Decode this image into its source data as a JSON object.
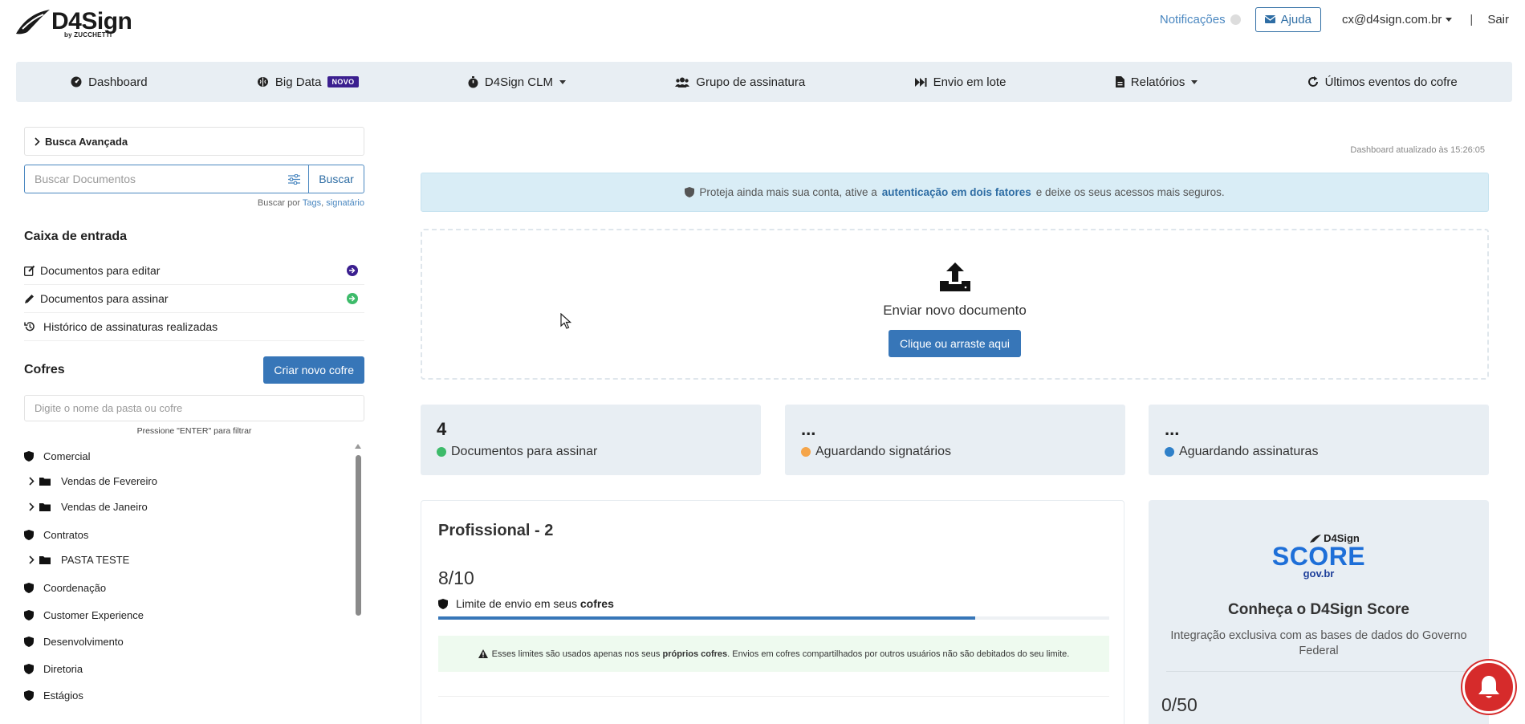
{
  "header": {
    "logo_text": "D4Sign",
    "logo_sub": "by ZUCCHETTI",
    "notifications_label": "Notificações",
    "help_label": "Ajuda",
    "user_email": "cx@d4sign.com.br",
    "separator": "|",
    "logout_label": "Sair"
  },
  "nav": {
    "items": [
      {
        "label": "Dashboard",
        "icon": "dashboard-icon"
      },
      {
        "label": "Big Data",
        "icon": "brain-icon",
        "badge": "NOVO"
      },
      {
        "label": "D4Sign CLM",
        "icon": "stopwatch-icon",
        "dropdown": true
      },
      {
        "label": "Grupo de assinatura",
        "icon": "users-icon"
      },
      {
        "label": "Envio em lote",
        "icon": "fast-forward-icon"
      },
      {
        "label": "Relatórios",
        "icon": "file-report-icon",
        "dropdown": true
      },
      {
        "label": "Últimos eventos do cofre",
        "icon": "refresh-icon"
      }
    ]
  },
  "sidebar": {
    "advanced_search": "Busca Avançada",
    "search_placeholder": "Buscar Documentos",
    "search_button": "Buscar",
    "search_hint_prefix": "Buscar por",
    "search_hint_tags": "Tags",
    "search_hint_comma": ",",
    "search_hint_signer": "signatário",
    "inbox_title": "Caixa de entrada",
    "inbox_items": [
      {
        "label": "Documentos para editar",
        "icon": "edit-icon"
      },
      {
        "label": "Documentos para assinar",
        "icon": "pencil-icon"
      },
      {
        "label": "Histórico de assinaturas realizadas",
        "icon": "history-icon"
      }
    ],
    "vaults_title": "Cofres",
    "new_vault_button": "Criar novo cofre",
    "vault_filter_placeholder": "Digite o nome da pasta ou cofre",
    "vault_filter_hint": "Pressione \"ENTER\" para filtrar",
    "vaults": [
      {
        "label": "Comercial",
        "type": "vault"
      },
      {
        "label": "Vendas de Fevereiro",
        "type": "folder"
      },
      {
        "label": "Vendas de Janeiro",
        "type": "folder"
      },
      {
        "label": "Contratos",
        "type": "vault"
      },
      {
        "label": "PASTA TESTE",
        "type": "folder"
      },
      {
        "label": "Coordenação",
        "type": "vault"
      },
      {
        "label": "Customer Experience",
        "type": "vault"
      },
      {
        "label": "Desenvolvimento",
        "type": "vault"
      },
      {
        "label": "Diretoria",
        "type": "vault"
      },
      {
        "label": "Estágios",
        "type": "vault"
      }
    ]
  },
  "main": {
    "updated_text": "Dashboard atualizado às 15:26:05",
    "alert_prefix": "Proteja ainda mais sua conta, ative a",
    "alert_link": "autenticação em dois fatores",
    "alert_suffix": "e deixe os seus acessos mais seguros.",
    "upload_label": "Enviar novo documento",
    "upload_button": "Clique ou arraste aqui",
    "stats": [
      {
        "value": "4",
        "label": "Documentos para assinar",
        "color": "#3dbb6a"
      },
      {
        "value": "...",
        "label": "Aguardando signatários",
        "color": "#f5a54a"
      },
      {
        "value": "...",
        "label": "Aguardando assinaturas",
        "color": "#2f80c9"
      }
    ],
    "plan": {
      "title": "Profissional - 2",
      "usage": "8/10",
      "progress_fraction": 0.8,
      "limit_prefix": "Limite de envio em seus",
      "limit_bold": "cofres",
      "note_prefix": "Esses limites são usados apenas nos seus",
      "note_bold": "próprios cofres",
      "note_suffix": ". Envios em cofres compartilhados por outros usuários não são debitados do seu limite."
    },
    "score": {
      "logo_top": "D4Sign",
      "logo_big": "SCORE",
      "logo_gov": "gov.br",
      "title": "Conheça o D4Sign Score",
      "description": "Integração exclusiva com as bases de dados do Governo Federal",
      "count": "0/50"
    }
  },
  "colors": {
    "brand_blue": "#3776b8",
    "nav_bg": "#e8eef3",
    "badge_purple": "#3b1f8f",
    "chat_red": "#d62b2b"
  }
}
